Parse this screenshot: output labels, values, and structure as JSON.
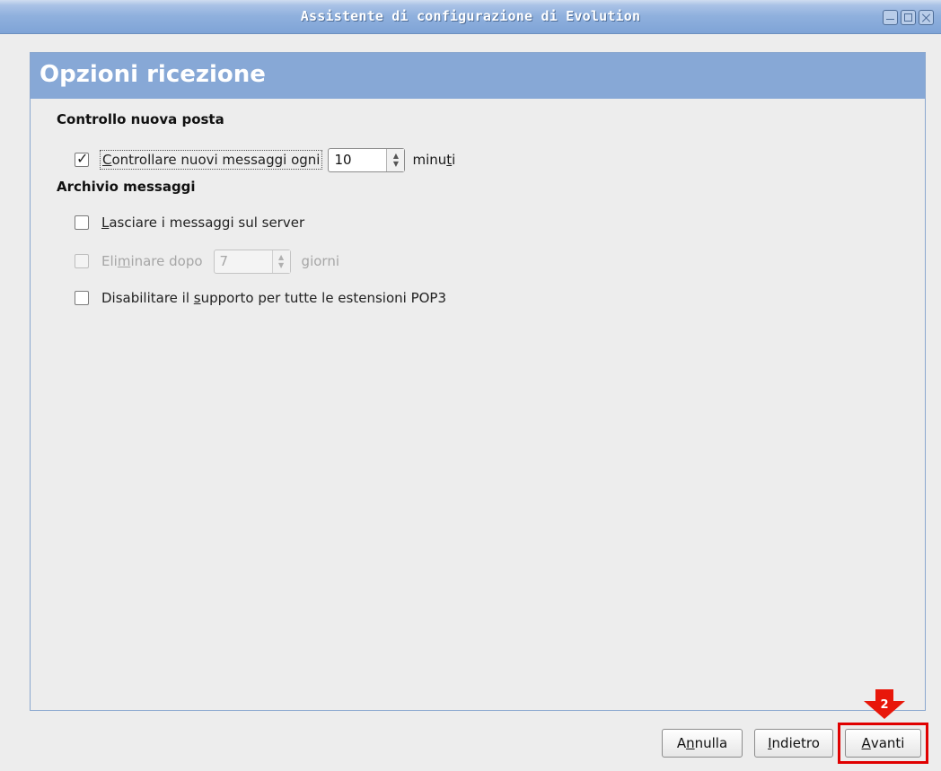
{
  "window": {
    "title": "Assistente di configurazione di Evolution",
    "controls": [
      "minimize-icon",
      "maximize-icon",
      "close-icon"
    ]
  },
  "page": {
    "title": "Opzioni ricezione"
  },
  "check_mail": {
    "section_title": "Controllo nuova posta",
    "checkbox_label_prefix": "",
    "checkbox_mnemonic": "C",
    "checkbox_label_rest": "ontrollare nuovi messaggi ogni",
    "checked": true,
    "interval_value": "10",
    "unit_prefix": "minu",
    "unit_mnemonic": "t",
    "unit_rest": "i"
  },
  "archive": {
    "section_title": "Archivio messaggi",
    "leave_on_server": {
      "mnemonic": "L",
      "label_rest": "asciare i messaggi sul server",
      "checked": false
    },
    "delete_after": {
      "label_prefix": "Eli",
      "mnemonic": "m",
      "label_rest": "inare dopo",
      "checked": false,
      "days_value": "7",
      "unit": "giorni",
      "disabled": true
    },
    "disable_pop3": {
      "label_prefix": "Disabilitare il ",
      "mnemonic": "s",
      "label_rest": "upporto per tutte le estensioni POP3",
      "checked": false
    }
  },
  "buttons": {
    "cancel": {
      "prefix": "A",
      "mnemonic": "n",
      "rest": "nulla"
    },
    "back": {
      "prefix": "",
      "mnemonic": "I",
      "rest": "ndietro"
    },
    "next": {
      "prefix": "",
      "mnemonic": "A",
      "rest": "vanti"
    }
  },
  "annotation": {
    "step_number": "2",
    "color": "#e00000"
  },
  "colors": {
    "title_bar": "#7ea3d6",
    "page_header": "#87a8d6",
    "background": "#ededed"
  }
}
